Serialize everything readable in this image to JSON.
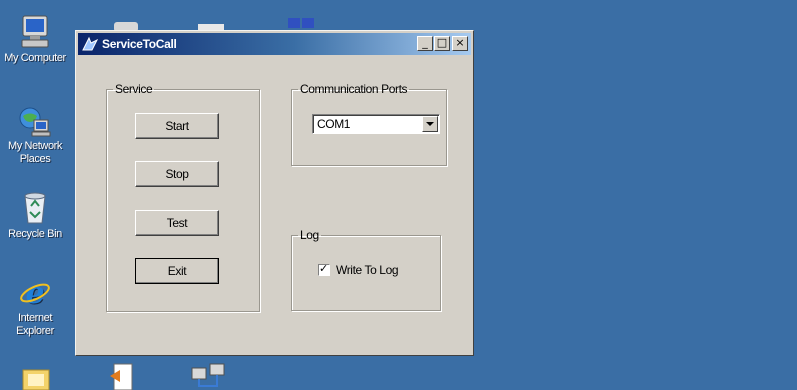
{
  "desktop": {
    "background": "#3a6ea5",
    "icons": [
      {
        "label": "My Computer",
        "icon": "computer-icon"
      },
      {
        "label": "My Network Places",
        "label_line1": "My Network",
        "label_line2": "Places",
        "icon": "network-places-icon"
      },
      {
        "label": "Recycle Bin",
        "icon": "recycle-bin-icon"
      },
      {
        "label": "Internet Explorer",
        "label_line1": "Internet",
        "label_line2": "Explorer",
        "icon": "internet-explorer-icon"
      }
    ]
  },
  "window": {
    "title": "ServiceToCall",
    "controls": {
      "minimize": "_",
      "maximize": "□",
      "close": "×"
    },
    "service_group": {
      "legend": "Service",
      "buttons": {
        "start": "Start",
        "stop": "Stop",
        "test": "Test",
        "exit": "Exit"
      }
    },
    "ports_group": {
      "legend": "Communication Ports",
      "selected_port": "COM1"
    },
    "log_group": {
      "legend": "Log",
      "checkbox_label": "Write To Log",
      "checked": true
    }
  }
}
